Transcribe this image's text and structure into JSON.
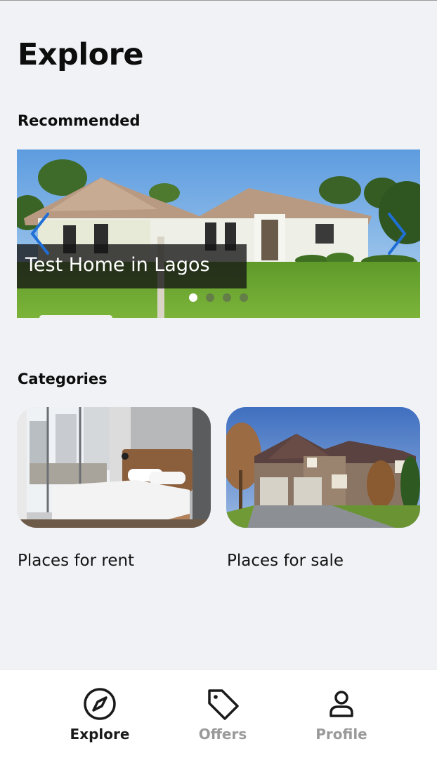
{
  "page": {
    "title": "Explore"
  },
  "recommended": {
    "section_title": "Recommended",
    "slides": [
      {
        "caption": "Test Home in Lagos",
        "active": true
      },
      {
        "active": false
      },
      {
        "active": false
      },
      {
        "active": false
      }
    ],
    "prev_icon": "chevron-left-icon",
    "next_icon": "chevron-right-icon",
    "arrow_color": "#1f6fd6"
  },
  "categories": {
    "section_title": "Categories",
    "items": [
      {
        "label": "Places for rent",
        "image": "bedroom-photo"
      },
      {
        "label": "Places for sale",
        "image": "house-photo"
      }
    ]
  },
  "bottom_nav": {
    "items": [
      {
        "label": "Explore",
        "icon": "compass-icon",
        "active": true
      },
      {
        "label": "Offers",
        "icon": "tag-icon",
        "active": false
      },
      {
        "label": "Profile",
        "icon": "user-icon",
        "active": false
      }
    ]
  }
}
